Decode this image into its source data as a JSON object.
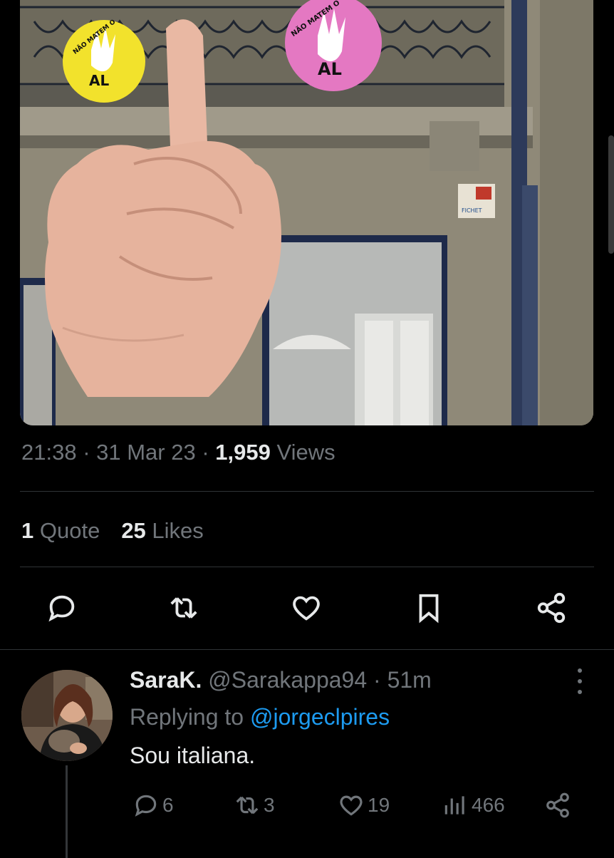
{
  "tweet": {
    "image": {
      "description_icons": [
        "raised-hand-icon",
        "middle-finger-hand"
      ],
      "sign_left_text": [
        "NÃO MATEM O",
        "AL"
      ],
      "sign_right_text": [
        "NÃO MATEM O",
        "AL"
      ],
      "alarm_label": "FICHET"
    },
    "meta": {
      "time": "21:38",
      "sep1": " · ",
      "date": "31 Mar 23",
      "sep2": " · ",
      "views_count": "1,959",
      "views_label": " Views"
    },
    "stats": {
      "quotes_count": "1",
      "quotes_label": " Quote",
      "likes_count": "25",
      "likes_label": " Likes"
    },
    "actions": [
      "reply-icon",
      "retweet-icon",
      "like-icon",
      "bookmark-icon",
      "share-icon"
    ]
  },
  "reply": {
    "name": "SaraK.",
    "handle": " @Sarakappa94 · 51m",
    "replying_prefix": "Replying to ",
    "replying_handle": "@jorgeclpires",
    "text": "Sou italiana.",
    "counts": {
      "replies": "6",
      "retweets": "3",
      "likes": "19",
      "views": "466"
    }
  },
  "colors": {
    "background": "#000000",
    "text_primary": "#e7e9ea",
    "text_secondary": "#71767b",
    "link": "#1d9bf0",
    "divider": "#2f3336"
  }
}
